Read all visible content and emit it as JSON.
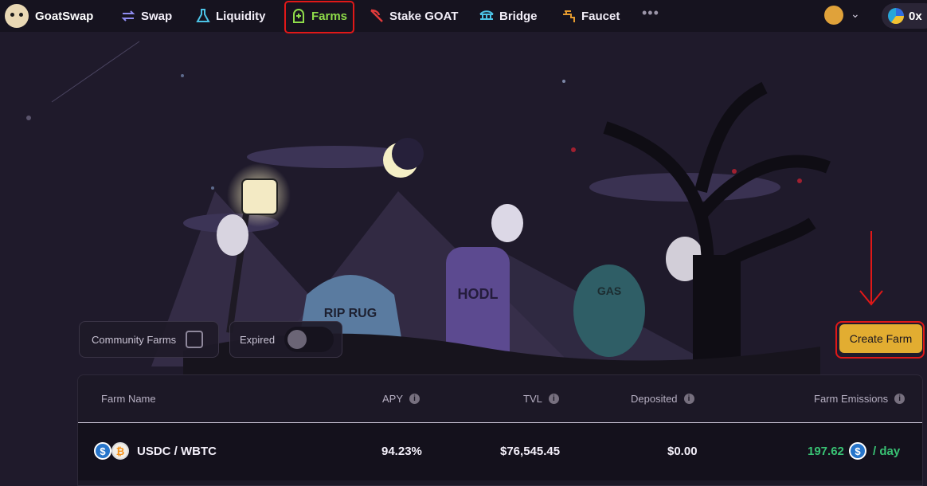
{
  "brand": {
    "name": "GoatSwap",
    "logo_icon": "goat-logo-icon"
  },
  "nav": {
    "items": [
      {
        "label": "Swap",
        "icon": "swap-arrows-icon",
        "color": "#8f8cf0"
      },
      {
        "label": "Liquidity",
        "icon": "flask-icon",
        "color": "#4cc3e6"
      },
      {
        "label": "Farms",
        "icon": "tombstone-plus-icon",
        "color": "#8fdc4a",
        "active": true
      },
      {
        "label": "Stake GOAT",
        "icon": "scythe-icon",
        "color": "#e23b3b"
      },
      {
        "label": "Bridge",
        "icon": "bridge-icon",
        "color": "#4cc3e6"
      },
      {
        "label": "Faucet",
        "icon": "faucet-icon",
        "color": "#e59b2f"
      }
    ],
    "more": "•••",
    "wallet_address_prefix": "0x"
  },
  "filters": {
    "community_label": "Community Farms",
    "community_checked": false,
    "expired_label": "Expired",
    "expired_on": false
  },
  "create_farm_label": "Create Farm",
  "hero_scene": {
    "tombstones": [
      "RIP RUG",
      "HODL",
      "GAS"
    ]
  },
  "table": {
    "headers": [
      "Farm Name",
      "APY",
      "TVL",
      "Deposited",
      "Farm Emissions"
    ],
    "rows": [
      {
        "pair": "USDC / WBTC",
        "apy": "94.23%",
        "tvl": "$76,545.45",
        "deposited": "$0.00",
        "emission_amount": "197.62",
        "emission_unit": "/ day"
      }
    ]
  },
  "colors": {
    "accent": "#e2ad31",
    "annotation": "#e01818",
    "positive": "#39c274"
  }
}
